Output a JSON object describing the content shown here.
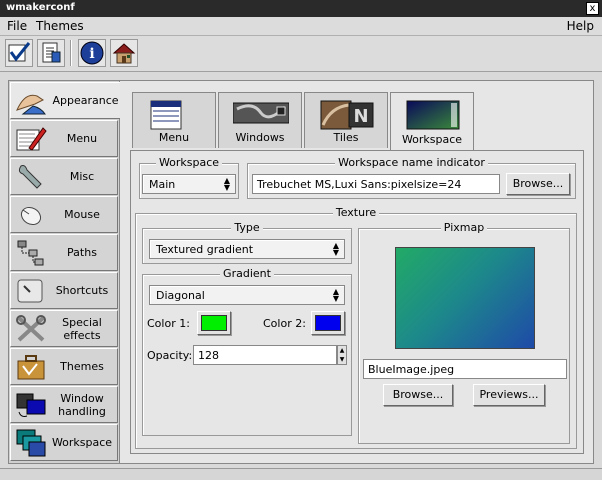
{
  "window": {
    "title": "wmakerconf",
    "close_glyph": "x"
  },
  "menubar": {
    "file": "File",
    "themes": "Themes",
    "help": "Help"
  },
  "toolbar": {
    "buttons": [
      {
        "icon": "checkmark-icon"
      },
      {
        "icon": "document-icon"
      },
      {
        "icon": "info-icon"
      },
      {
        "icon": "home-icon"
      }
    ]
  },
  "sidebar": {
    "items": [
      {
        "label": "Appearance",
        "icon": "appearance-hand-icon",
        "active": true
      },
      {
        "label": "Menu",
        "icon": "menu-pencil-icon"
      },
      {
        "label": "Misc",
        "icon": "wrench-icon"
      },
      {
        "label": "Mouse",
        "icon": "mouse-icon"
      },
      {
        "label": "Paths",
        "icon": "paths-icon"
      },
      {
        "label": "Shortcuts",
        "icon": "shortcut-key-icon"
      },
      {
        "label": "Special effects",
        "icon": "tools-icon"
      },
      {
        "label": "Themes",
        "icon": "briefcase-icon"
      },
      {
        "label": "Window handling",
        "icon": "window-handling-icon"
      },
      {
        "label": "Workspace",
        "icon": "workspace-icon"
      }
    ]
  },
  "tabs": [
    {
      "label": "Menu"
    },
    {
      "label": "Windows"
    },
    {
      "label": "Tiles"
    },
    {
      "label": "Workspace",
      "active": true
    }
  ],
  "workspace_group": {
    "title": "Workspace",
    "selected": "Main"
  },
  "indicator_group": {
    "title": "Workspace name indicator",
    "font_value": "Trebuchet MS,Luxi Sans:pixelsize=24",
    "browse_label": "Browse..."
  },
  "texture_group": {
    "title": "Texture",
    "type_title": "Type",
    "type_selected": "Textured gradient",
    "gradient_title": "Gradient",
    "gradient_selected": "Diagonal",
    "color1_label": "Color 1:",
    "color1": "#00ee00",
    "color2_label": "Color 2:",
    "color2": "#0000ee",
    "opacity_label": "Opacity:",
    "opacity_value": "128"
  },
  "pixmap_group": {
    "title": "Pixmap",
    "filename": "BlueImage.jpeg",
    "browse_label": "Browse...",
    "previews_label": "Previews..."
  }
}
